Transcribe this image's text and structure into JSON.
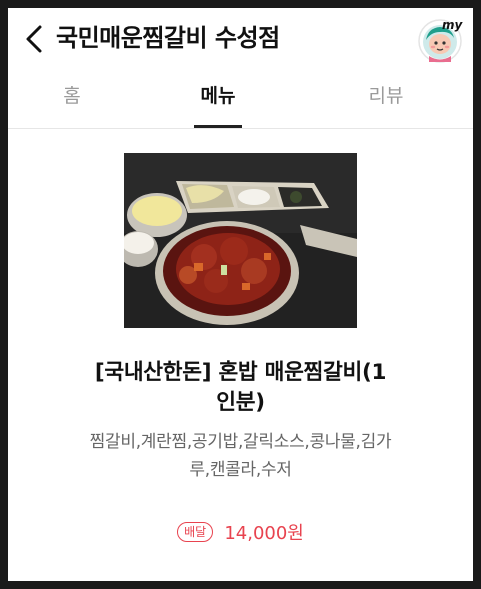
{
  "header": {
    "title": "국민매운찜갈비 수성점",
    "back_icon": "chevron-left-icon",
    "avatar_badge": "my"
  },
  "tabs": [
    {
      "label": "홈",
      "active": false
    },
    {
      "label": "메뉴",
      "active": true
    },
    {
      "label": "리뷰",
      "active": false
    }
  ],
  "menu_item": {
    "name_line1": "[국내산한돈] 혼밥 매운찜갈비(1",
    "name_line2": "인분)",
    "desc_line1": "찜갈비,계란찜,공기밥,갈릭소스,콩나물,김가",
    "desc_line2": "루,캔콜라,수저",
    "badge": "배달",
    "price": "14,000원"
  },
  "colors": {
    "accent": "#e8434f",
    "text": "#111111",
    "muted": "#666666",
    "tab_inactive": "#9a9a9a"
  }
}
